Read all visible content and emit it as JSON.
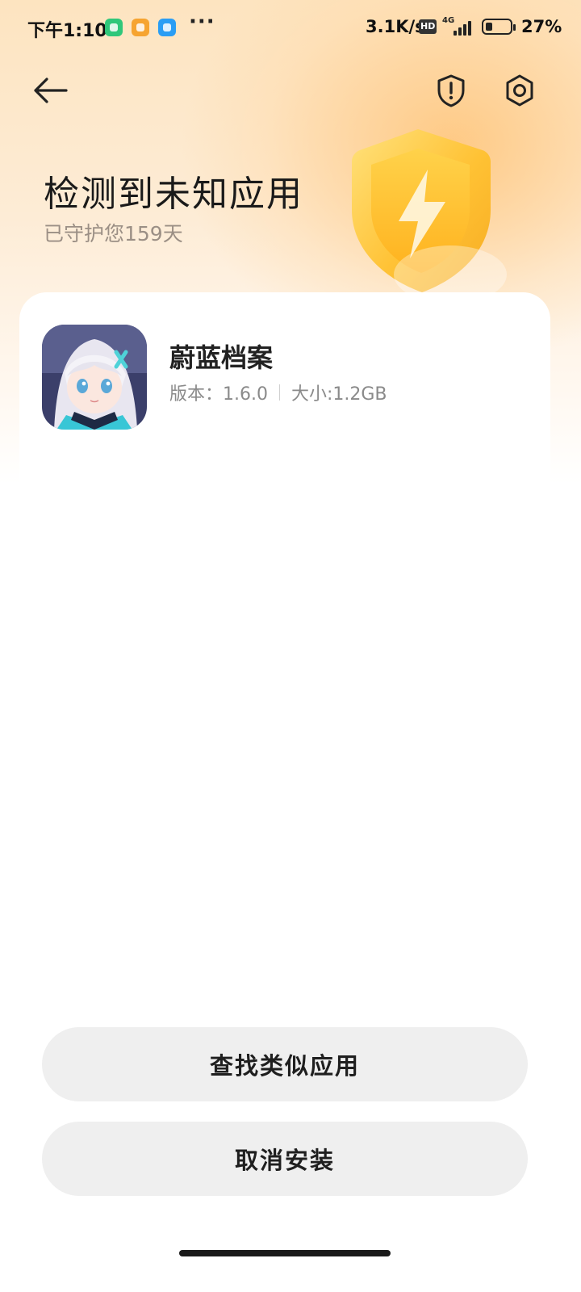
{
  "status_bar": {
    "time": "下午1:10",
    "more": "···",
    "net_speed": "3.1K/s",
    "hd_badge": "HD",
    "network_type": "4G",
    "battery_level_percent": 27,
    "battery_text": "27%"
  },
  "header": {
    "back_icon": "arrow-left-icon",
    "report_icon": "shield-alert-icon",
    "settings_icon": "gear-icon"
  },
  "hero": {
    "title": "检测到未知应用",
    "subtitle": "已守护您159天"
  },
  "app": {
    "name": "蔚蓝档案",
    "version": "版本：1.6.0",
    "size": "大小:1.2GB"
  },
  "actions": {
    "find_similar": "查找类似应用",
    "cancel_install": "取消安装"
  },
  "colors": {
    "accent": "#ffc23a",
    "button_bg": "#efefef"
  }
}
